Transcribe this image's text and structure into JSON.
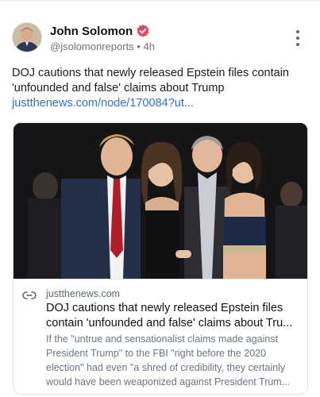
{
  "author": {
    "name": "John Solomon",
    "handle": "@jsolomonreports",
    "separator": "•",
    "time": "4h"
  },
  "post": {
    "text": "DOJ cautions that newly released Epstein files contain 'unfounded and false' claims about Trump",
    "link_text": "justthenews.com/node/170084?ut..."
  },
  "card": {
    "domain": "justthenews.com",
    "title": "DOJ cautions that newly released Epstein files contain 'unfounded and false' claims about Tru...",
    "description": "If the \"untrue and sensationalist claims made against President Trump\" to the FBI \"right before the 2020 election\" had even \"a shred of credibility, they certainly would have been weaponized against President Trum..."
  },
  "icons": {
    "verified": "verified-badge-icon",
    "more": "more-vertical-icon",
    "link": "link-icon"
  },
  "colors": {
    "link": "#2f6fd1",
    "verified": "#e3485e",
    "muted": "#6b7480"
  }
}
